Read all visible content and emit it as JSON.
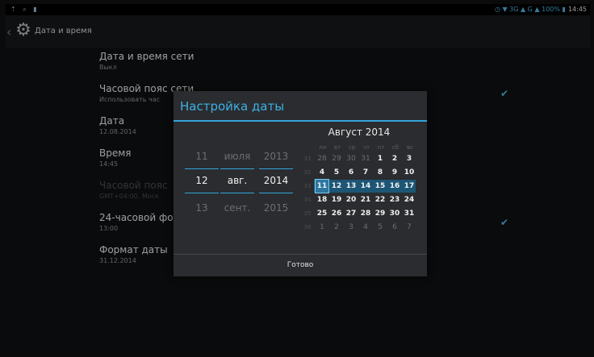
{
  "statusbar": {
    "left_icons": "⇡ ⌕ ▮",
    "right_status": "◷ ▼ 3G ▲ G ▲ 100% ▮",
    "time": "14:45"
  },
  "actionbar": {
    "title": "Дата и время"
  },
  "settings": [
    {
      "title": "Дата и время сети",
      "summary": "Выкл"
    },
    {
      "title": "Часовой пояс сети",
      "summary": "Использовать час"
    },
    {
      "title": "Дата",
      "summary": "12.08.2014"
    },
    {
      "title": "Время",
      "summary": "14:45"
    },
    {
      "title": "Часовой пояс",
      "summary": "GMT+04:00, Моск"
    },
    {
      "title": "24-часовой фо",
      "summary": "13:00"
    },
    {
      "title": "Формат даты",
      "summary": "31.12.2014"
    }
  ],
  "dialog": {
    "title": "Настройка даты",
    "day": {
      "prev": "11",
      "cur": "12",
      "next": "13"
    },
    "month": {
      "prev": "июля",
      "cur": "авг.",
      "next": "сент."
    },
    "year": {
      "prev": "2013",
      "cur": "2014",
      "next": "2015"
    },
    "calendar": {
      "month_title": "Август 2014",
      "dows": [
        "пн",
        "вт",
        "ср",
        "чт",
        "пт",
        "сб",
        "вс"
      ],
      "weeks": [
        {
          "num": "31",
          "days": [
            "28",
            "29",
            "30",
            "31",
            "1",
            "2",
            "3"
          ]
        },
        {
          "num": "32",
          "days": [
            "4",
            "5",
            "6",
            "7",
            "8",
            "9",
            "10"
          ]
        },
        {
          "num": "33",
          "days": [
            "11",
            "12",
            "13",
            "14",
            "15",
            "16",
            "17"
          ]
        },
        {
          "num": "34",
          "days": [
            "18",
            "19",
            "20",
            "21",
            "22",
            "23",
            "24"
          ]
        },
        {
          "num": "35",
          "days": [
            "25",
            "26",
            "27",
            "28",
            "29",
            "30",
            "31"
          ]
        },
        {
          "num": "36",
          "days": [
            "1",
            "2",
            "3",
            "4",
            "5",
            "6",
            "7"
          ]
        }
      ]
    },
    "done_label": "Готово"
  },
  "colors": {
    "accent": "#33a5dc",
    "selection": "#1e5a7a"
  }
}
